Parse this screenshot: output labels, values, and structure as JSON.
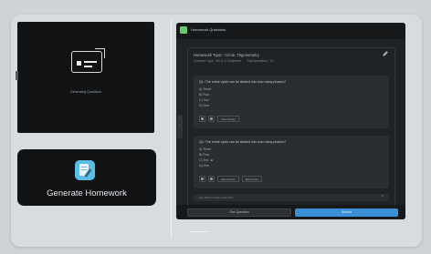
{
  "generator": {
    "status_text": "Generating Questions"
  },
  "generate_button": {
    "label": "Generate Homework"
  },
  "modal": {
    "title": "Homework Questions",
    "topic": "Homework Topic : Circle, Trigonometry",
    "question_type": "Question Type : MCQ & Subjective",
    "total_questions": "Total questions : 10",
    "questions": [
      {
        "text": "Q1. The entire cycle can be divided into how many phases?",
        "options": [
          "A) Three",
          "B) Four",
          "C) Two",
          "D) One"
        ],
        "correct_index": null,
        "action_label": "View Answer"
      },
      {
        "text": "Q2. The entire cycle can be divided into how many phases?",
        "options": [
          "A) Three",
          "B) Four",
          "C) Two",
          "D) One"
        ],
        "correct_index": 2,
        "action_labels": [
          "Hide Answer",
          "Edit Answer"
        ]
      }
    ],
    "collapsed_question": "Q3. DNS G Status and VCS",
    "reset_label": "Get Question",
    "submit_label": "Submit"
  },
  "icons": {
    "generator": "document-list-icon",
    "generate_button": "homework-pencil-icon",
    "modal_logo": "app-logo-icon",
    "edit": "pencil-icon",
    "chevron": "chevron-up-icon"
  },
  "colors": {
    "accent": "#3a8fd6",
    "button_icon_bg": "#5bbde6",
    "logo": "#6cc96a"
  }
}
